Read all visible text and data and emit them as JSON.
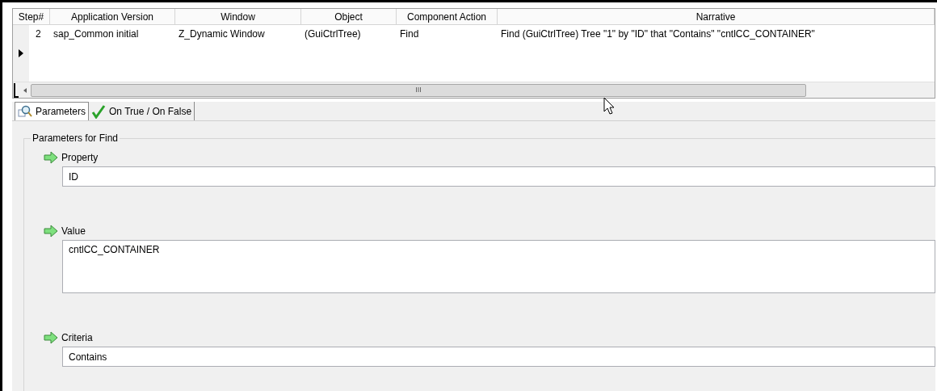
{
  "grid": {
    "columns": [
      "Step#",
      "Application Version",
      "Window",
      "Object",
      "Component Action",
      "Narrative"
    ],
    "rows": [
      {
        "selected": true,
        "cells": [
          "2",
          "sap_Common initial",
          "Z_Dynamic Window",
          "(GuiCtrlTree)",
          "Find",
          "Find (GuiCtrlTree) Tree \"1\" by \"ID\" that \"Contains\" \"cntlCC_CONTAINER\""
        ]
      }
    ],
    "scrollbar_thumb": "III"
  },
  "tabs": [
    {
      "label": "Parameters",
      "selected": true,
      "kind": "params"
    },
    {
      "label": "On True / On False",
      "selected": false,
      "kind": "check"
    }
  ],
  "group": {
    "title": "Parameters for Find",
    "fields": [
      {
        "label": "Property",
        "value": "ID",
        "kind": "single"
      },
      {
        "label": "Value",
        "value": "cntlCC_CONTAINER",
        "kind": "multi"
      },
      {
        "label": "Criteria",
        "value": "Contains",
        "kind": "single"
      }
    ]
  }
}
